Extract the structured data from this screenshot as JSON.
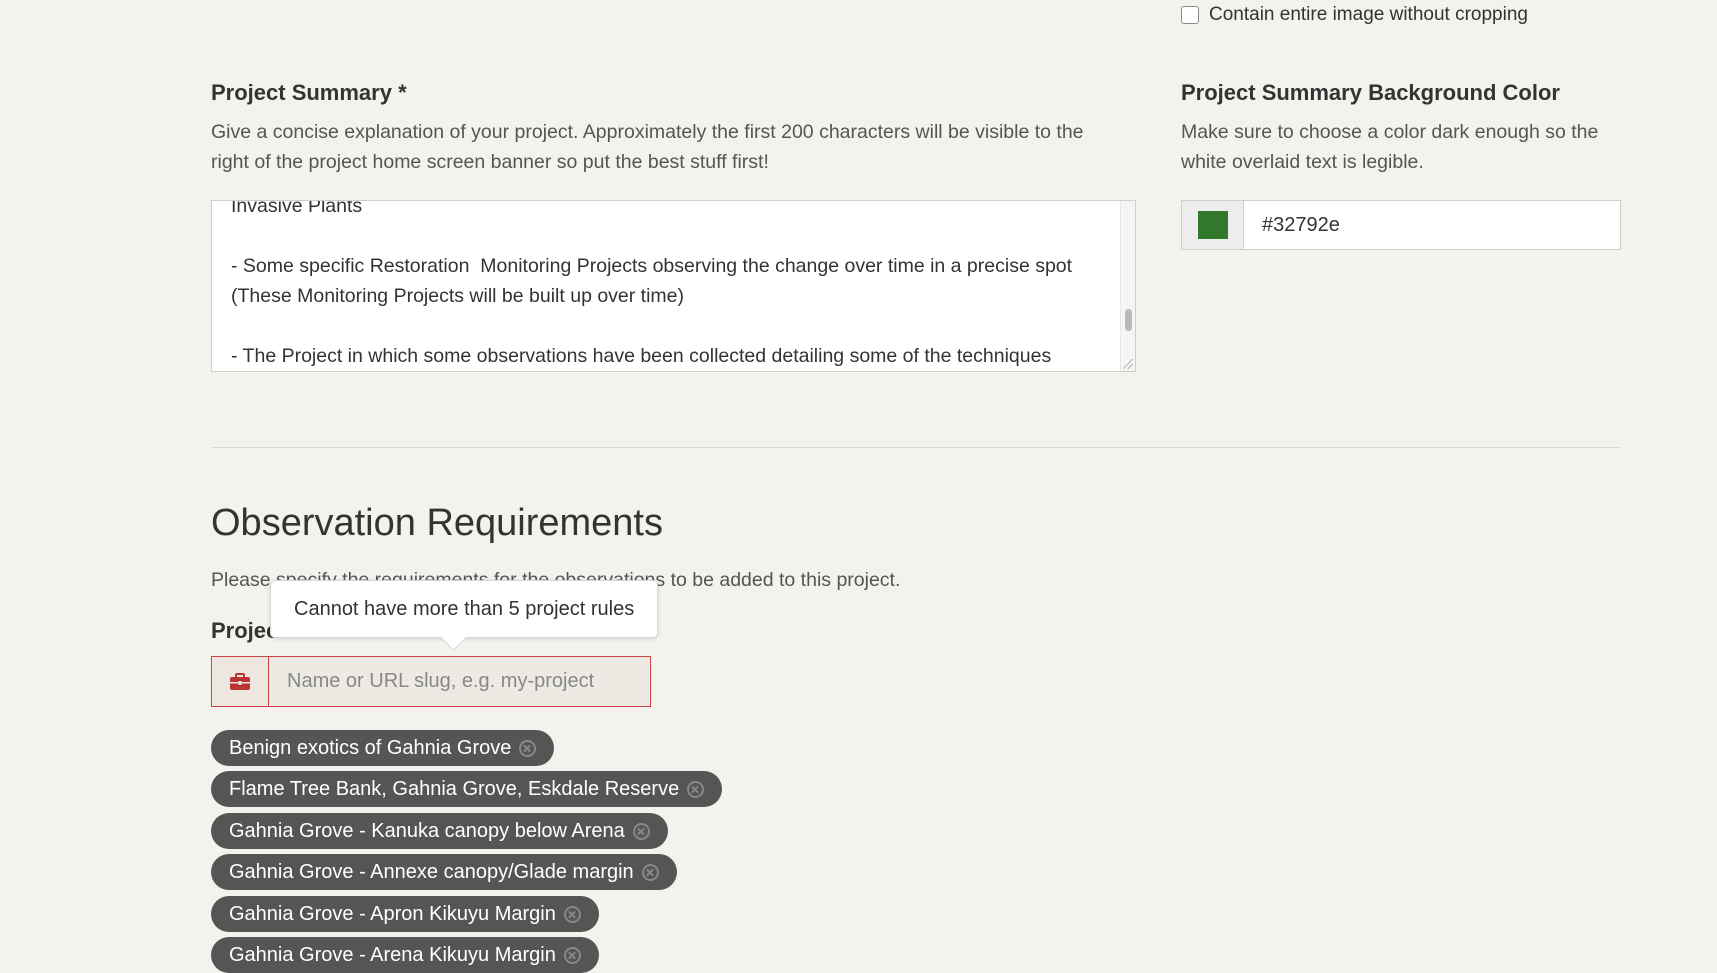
{
  "crop_option": {
    "label": "Contain entire image without cropping"
  },
  "summary": {
    "label": "Project Summary *",
    "help_line1": "Give a concise explanation of your project. Approximately the first 200 characters will be visible to the",
    "help_line2": "right of the project home screen banner so put the best stuff first!",
    "text": "Invasive Plants\n\n- Some specific Restoration  Monitoring Projects observing the change over time in a precise spot\n(These Monitoring Projects will be built up over time)\n\n- The Project in which some observations have been collected detailing some of the techniques"
  },
  "bg_color": {
    "label": "Project Summary Background Color",
    "help_line1": "Make sure to choose a color dark enough so the",
    "help_line2": "white overlaid text is legible.",
    "value": "#32792e"
  },
  "requirements": {
    "title": "Observation Requirements",
    "subtitle": "Please specify the requirements for the observations to be added to this project.",
    "project_label": "Projec",
    "tooltip": "Cannot have more than 5 project rules",
    "project_input_placeholder": "Name or URL slug, e.g. my-project",
    "icon": "briefcase-icon",
    "error_color": "#cc4444",
    "projects": [
      "Benign exotics of Gahnia Grove",
      "Flame Tree Bank, Gahnia Grove, Eskdale Reserve",
      "Gahnia Grove - Kanuka canopy below Arena",
      "Gahnia Grove - Annexe canopy/Glade margin",
      "Gahnia Grove - Apron Kikuyu Margin",
      "Gahnia Grove - Arena Kikuyu Margin"
    ]
  }
}
